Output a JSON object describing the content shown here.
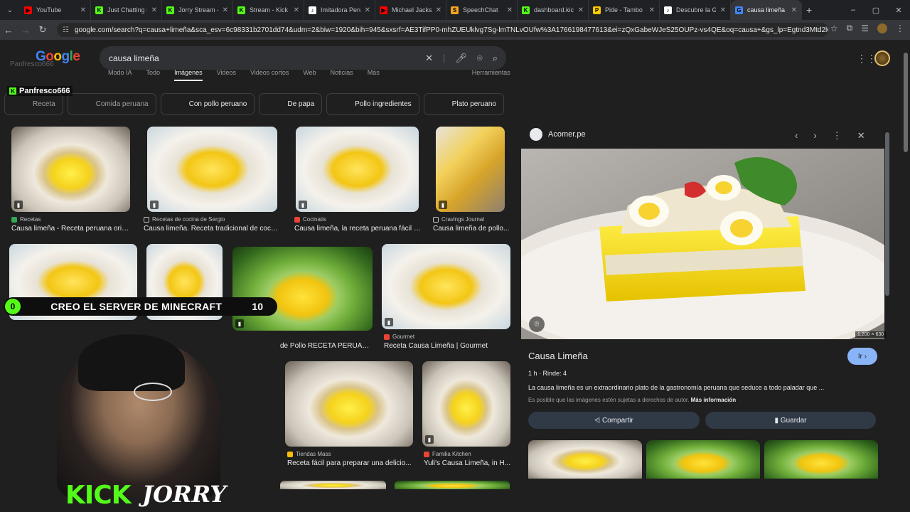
{
  "tabs": [
    {
      "title": "YouTube",
      "color": "#ff0000",
      "glyph": "▶"
    },
    {
      "title": "Just Chatting S",
      "color": "#53fc18",
      "glyph": "K"
    },
    {
      "title": "Jorry Stream -",
      "color": "#53fc18",
      "glyph": "K"
    },
    {
      "title": "Stream - Kick E",
      "color": "#53fc18",
      "glyph": "K"
    },
    {
      "title": "Imitadora Peru",
      "color": "#ffffff",
      "glyph": "♪"
    },
    {
      "title": "Michael Jackso",
      "color": "#ff0000",
      "glyph": "▶"
    },
    {
      "title": "SpeechChat",
      "color": "#f5a623",
      "glyph": "S"
    },
    {
      "title": "dashboard.kick",
      "color": "#53fc18",
      "glyph": "K"
    },
    {
      "title": "Pide - Tambo |",
      "color": "#ffcc00",
      "glyph": "P"
    },
    {
      "title": "Descubre la Gu",
      "color": "#ffffff",
      "glyph": "♪"
    },
    {
      "title": "causa limeña -",
      "color": "#4285f4",
      "glyph": "G"
    }
  ],
  "url": "google.com/search?q=causa+limeña&sca_esv=6c98331b2701dd74&udm=2&biw=1920&bih=945&sxsrf=AE3TifPP0-mhZUEUklvg7Sg-lmTNLvOUfw%3A1766198477613&ei=zQxGabeWJeS25OUPz-vs4QE&oq=causa+&gs_lp=Egtnd3Mtd2l6LWltZyIG...",
  "search": {
    "query": "causa limeña"
  },
  "logo": [
    "G",
    "o",
    "o",
    "g",
    "l",
    "e"
  ],
  "ghost": "Panfresco666",
  "kick_user": "Panfresco666",
  "navtabs": [
    "Modo IA",
    "Todo",
    "Imágenes",
    "Videos",
    "Videos cortos",
    "Web",
    "Noticias",
    "Más",
    "Herramientas"
  ],
  "chips": [
    {
      "label": "Receta",
      "dim": true
    },
    {
      "label": "Comida peruana",
      "dim": true
    },
    {
      "label": "Con pollo peruano",
      "dim": false
    },
    {
      "label": "De papa",
      "dim": false
    },
    {
      "label": "Pollo ingredientes",
      "dim": false
    },
    {
      "label": "Plato peruano",
      "dim": false
    }
  ],
  "results": [
    {
      "source": "Recetas",
      "caption": "Causa limeña - Receta peruana origi...",
      "color": "#34a853"
    },
    {
      "source": "Recetas de cocina de Sergio",
      "caption": "Causa limeña. Receta tradicional de cocin...",
      "color": "#bdc1c6"
    },
    {
      "source": "Cocinatis",
      "caption": "Causa limeña, la receta peruana fácil y ...",
      "color": "#ea4335"
    },
    {
      "source": "Cravings Journal",
      "caption": "Causa limeña de pollo...",
      "color": "#bdc1c6"
    },
    {
      "source": "",
      "caption": "de Pollo RECETA PERUAN...",
      "color": "#bdc1c6"
    },
    {
      "source": "Gourmet",
      "caption": "Receta Causa Limeña | Gourmet",
      "color": "#ea4335"
    },
    {
      "source": "Tiendas Mass",
      "caption": "Receta fácil para preparar una delicio...",
      "color": "#fbbc05"
    },
    {
      "source": "Familia Kitchen",
      "caption": "Yuli's Causa Limeña, in H...",
      "color": "#ea4335"
    }
  ],
  "panel": {
    "site": "Acomer.pe",
    "title": "Causa Limeña",
    "go": "Ir",
    "meta": "1 h · Rinde: 4",
    "desc": "La causa limeña es un extraordinario plato de la gastronomía peruana que seduce a todo paladar que ...",
    "rights": "Es posible que las imágenes estén sujetas a derechos de autor.",
    "more": "Más información",
    "share": "Compartir",
    "save": "Guardar",
    "dims": "1,200 × 630"
  },
  "stream": {
    "goal_current": "0",
    "goal_text": "CREO EL SERVER DE MINECRAFT",
    "goal_target": "10",
    "brand": "KICK",
    "streamer": "JORRY"
  }
}
